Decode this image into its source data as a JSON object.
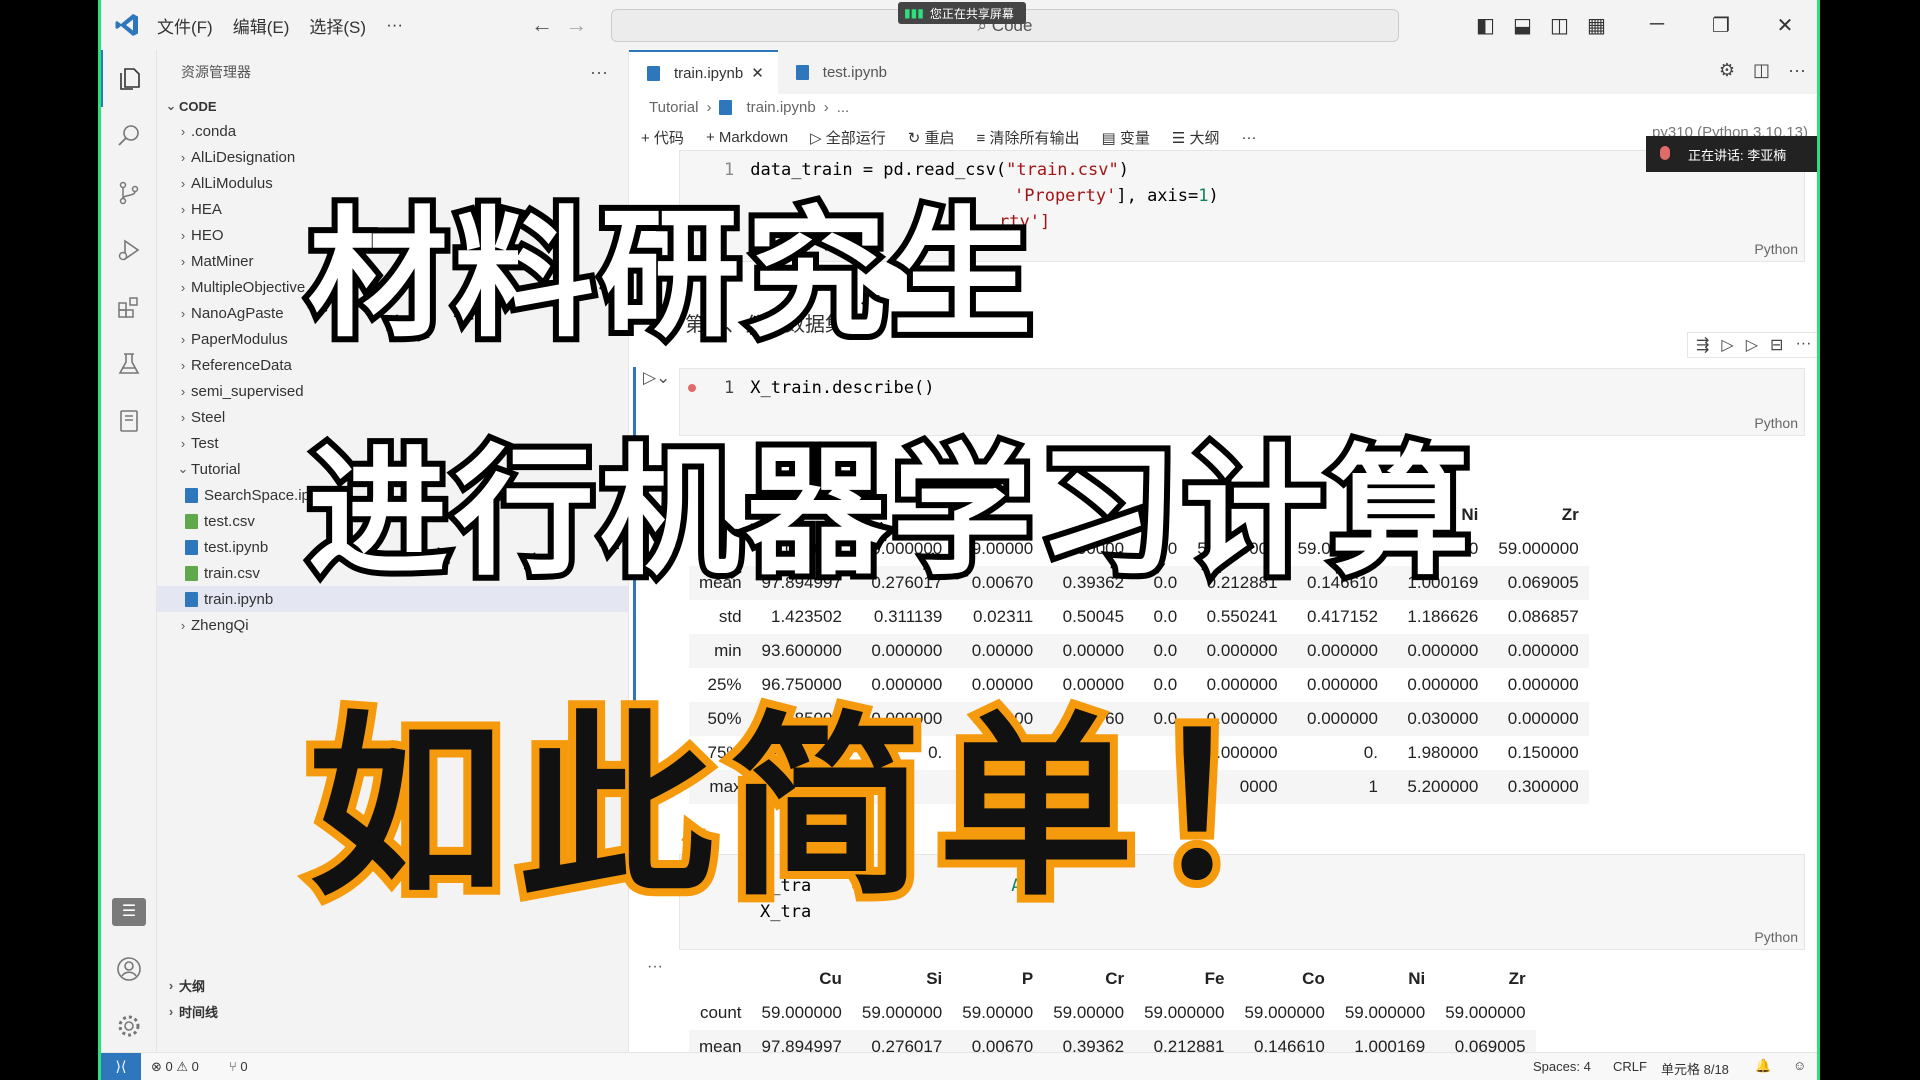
{
  "titlebar": {
    "menu": [
      "文件(F)",
      "编辑(E)",
      "选择(S)",
      "···"
    ],
    "search_text": "Code",
    "share_notice": "您正在共享屏幕"
  },
  "explorer": {
    "header": "资源管理器",
    "section": "CODE",
    "folders": [
      ".conda",
      "AlLiDesignation",
      "AlLiModulus",
      "HEA",
      "HEO",
      "MatMiner",
      "MultipleObjective",
      "NanoAgPaste",
      "PaperModulus",
      "ReferenceData",
      "semi_supervised",
      "Steel",
      "Test"
    ],
    "open_folder": "Tutorial",
    "files": [
      {
        "name": "SearchSpace.ipynb",
        "type": "notebook"
      },
      {
        "name": "test.csv",
        "type": "csv"
      },
      {
        "name": "test.ipynb",
        "type": "notebook"
      },
      {
        "name": "train.csv",
        "type": "csv"
      },
      {
        "name": "train.ipynb",
        "type": "notebook"
      }
    ],
    "after": "ZhengQi",
    "outline": "大纲",
    "timeline": "时间线"
  },
  "tabs": [
    "train.ipynb",
    "test.ipynb"
  ],
  "breadcrumb": [
    "Tutorial",
    "train.ipynb",
    "..."
  ],
  "toolbar": [
    "+ 代码",
    "+ Markdown",
    "全部运行",
    "重启",
    "清除所有输出",
    "变量",
    "大纲",
    "···"
  ],
  "kernel": "py310 (Python 3.10.13)",
  "speaking": "正在讲话: 李亚楠",
  "cell1": {
    "line_no": "1",
    "code_line1_a": "data_train = pd.read_csv(",
    "code_line1_str": "\"train.csv\"",
    "code_line1_b": ")",
    "code_line2_str": "'Property'",
    "code_line2_b": "], axis=",
    "code_line2_num": "1",
    "code_line2_c": ")",
    "code_line3": "rty']",
    "lang": "Python"
  },
  "markdown_heading": "第四、分析数据集",
  "cell2": {
    "line_no": "1",
    "code": "X_train.describe()",
    "lang": "Python"
  },
  "table1": {
    "headers": [
      "",
      "",
      "",
      "",
      "",
      "",
      "",
      "",
      "Ni",
      "Zr"
    ],
    "rows": [
      [
        "count",
        "59.000000",
        "59.000000",
        "59.00000",
        "59.00000",
        "59.0",
        "59.000000",
        "59.000000",
        "59.000000",
        "59.000000"
      ],
      [
        "mean",
        "97.894997",
        "0.276017",
        "0.00670",
        "0.39362",
        "0.0",
        "0.212881",
        "0.146610",
        "1.000169",
        "0.069005"
      ],
      [
        "std",
        "1.423502",
        "0.311139",
        "0.02311",
        "0.50045",
        "0.0",
        "0.550241",
        "0.417152",
        "1.186626",
        "0.086857"
      ],
      [
        "min",
        "93.600000",
        "0.000000",
        "0.00000",
        "0.00000",
        "0.0",
        "0.000000",
        "0.000000",
        "0.000000",
        "0.000000"
      ],
      [
        "25%",
        "96.750000",
        "0.000000",
        "0.00000",
        "0.00000",
        "0.0",
        "0.000000",
        "0.000000",
        "0.000000",
        "0.000000"
      ],
      [
        "50%",
        "97.585000",
        "0.000000",
        "0.00000",
        "0.00760",
        "0.0",
        "0.000000",
        "0.000000",
        "0.030000",
        "0.000000"
      ],
      [
        "75%",
        "99.170000",
        "0.",
        "0.00000",
        "",
        "",
        "0.000000",
        "0.",
        "1.980000",
        "0.150000"
      ],
      [
        "max",
        "9",
        "",
        "",
        "",
        "",
        "0000",
        "1",
        "5.200000",
        "0.300000"
      ]
    ]
  },
  "cell3": {
    "code_line1": "X_tra",
    "code_line1_tail": "Ag",
    "code_line2": "X_tra",
    "lang": "Python"
  },
  "table2": {
    "headers": [
      "",
      "Cu",
      "Si",
      "P",
      "Cr",
      "Fe",
      "Co",
      "Ni",
      "Zr"
    ],
    "rows": [
      [
        "count",
        "59.000000",
        "59.000000",
        "59.00000",
        "59.00000",
        "59.000000",
        "59.000000",
        "59.000000",
        "59.000000"
      ],
      [
        "mean",
        "97.894997",
        "0.276017",
        "0.00670",
        "0.39362",
        "0.212881",
        "0.146610",
        "1.000169",
        "0.069005"
      ],
      [
        "std",
        "1.423502",
        "0.311139",
        "0.02311",
        "0.50045",
        "0.550241",
        "0.417152",
        "1.186626",
        "0.086857"
      ]
    ]
  },
  "statusbar": {
    "errors": "⊗ 0 ⚠ 0",
    "ports": "⑂ 0",
    "spaces": "Spaces: 4",
    "eol": "CRLF",
    "cell": "单元格 8/18"
  },
  "overlay": {
    "line1": "材料研究生",
    "line2": "进行机器学习计算",
    "line3": "如此简单！"
  },
  "colors": {
    "accent": "#2f77bd",
    "frame": "#2de07a",
    "overlay_orange": "#f59a0c"
  }
}
